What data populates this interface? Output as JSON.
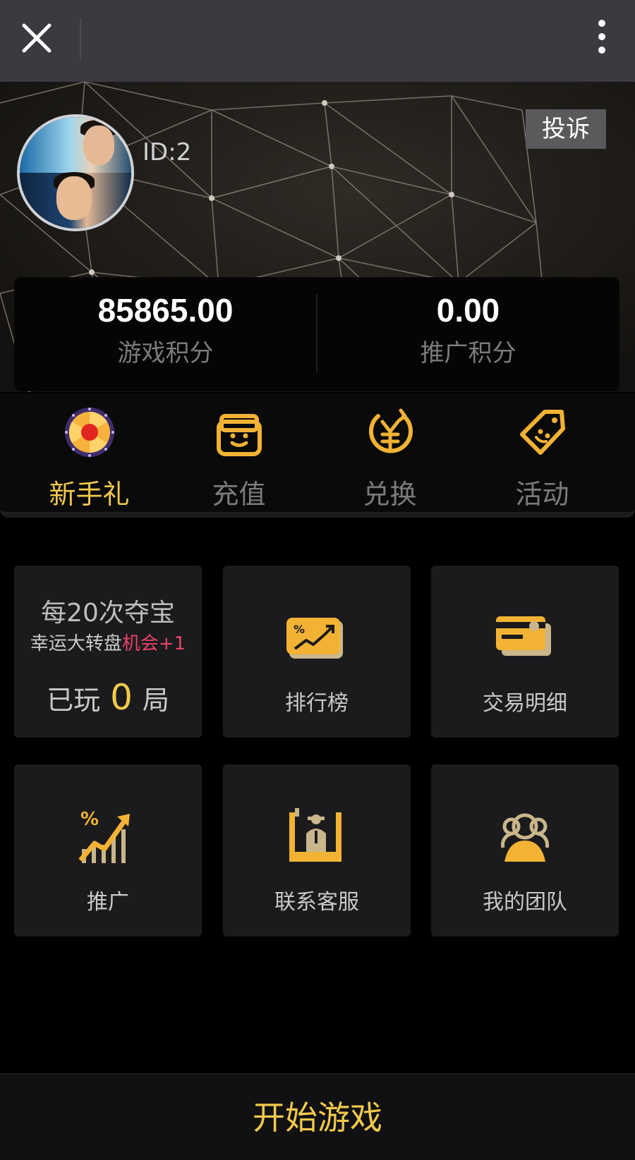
{
  "header": {
    "close_icon": "close-icon",
    "more_icon": "more-vertical-icon"
  },
  "profile": {
    "id_label": "ID:2",
    "complain_label": "投诉"
  },
  "points": {
    "game_points_value": "85865.00",
    "game_points_label": "游戏积分",
    "promo_points_value": "0.00",
    "promo_points_label": "推广积分"
  },
  "quick_actions": [
    {
      "label": "新手礼",
      "icon": "wheel-icon",
      "active": true
    },
    {
      "label": "充值",
      "icon": "wallet-icon",
      "active": false
    },
    {
      "label": "兑换",
      "icon": "yen-exchange-icon",
      "active": false
    },
    {
      "label": "活动",
      "icon": "tag-icon",
      "active": false
    }
  ],
  "treasure": {
    "title": "每20次夺宝",
    "sub_prefix": "幸运大转盘",
    "sub_highlight": "机会+1",
    "count_prefix": "已玩",
    "count_value": "0",
    "count_suffix": "局"
  },
  "menu": [
    {
      "label": "排行榜",
      "icon": "ranking-chart-icon"
    },
    {
      "label": "交易明细",
      "icon": "card-icon"
    },
    {
      "label": "推广",
      "icon": "growth-icon"
    },
    {
      "label": "联系客服",
      "icon": "customer-service-icon"
    },
    {
      "label": "我的团队",
      "icon": "team-icon"
    }
  ],
  "footer": {
    "start_label": "开始游戏"
  },
  "colors": {
    "accent": "#f2c94c",
    "highlight": "#e8436a",
    "card_bg": "#1b1b1d",
    "topbar_bg": "#3a3b40"
  }
}
